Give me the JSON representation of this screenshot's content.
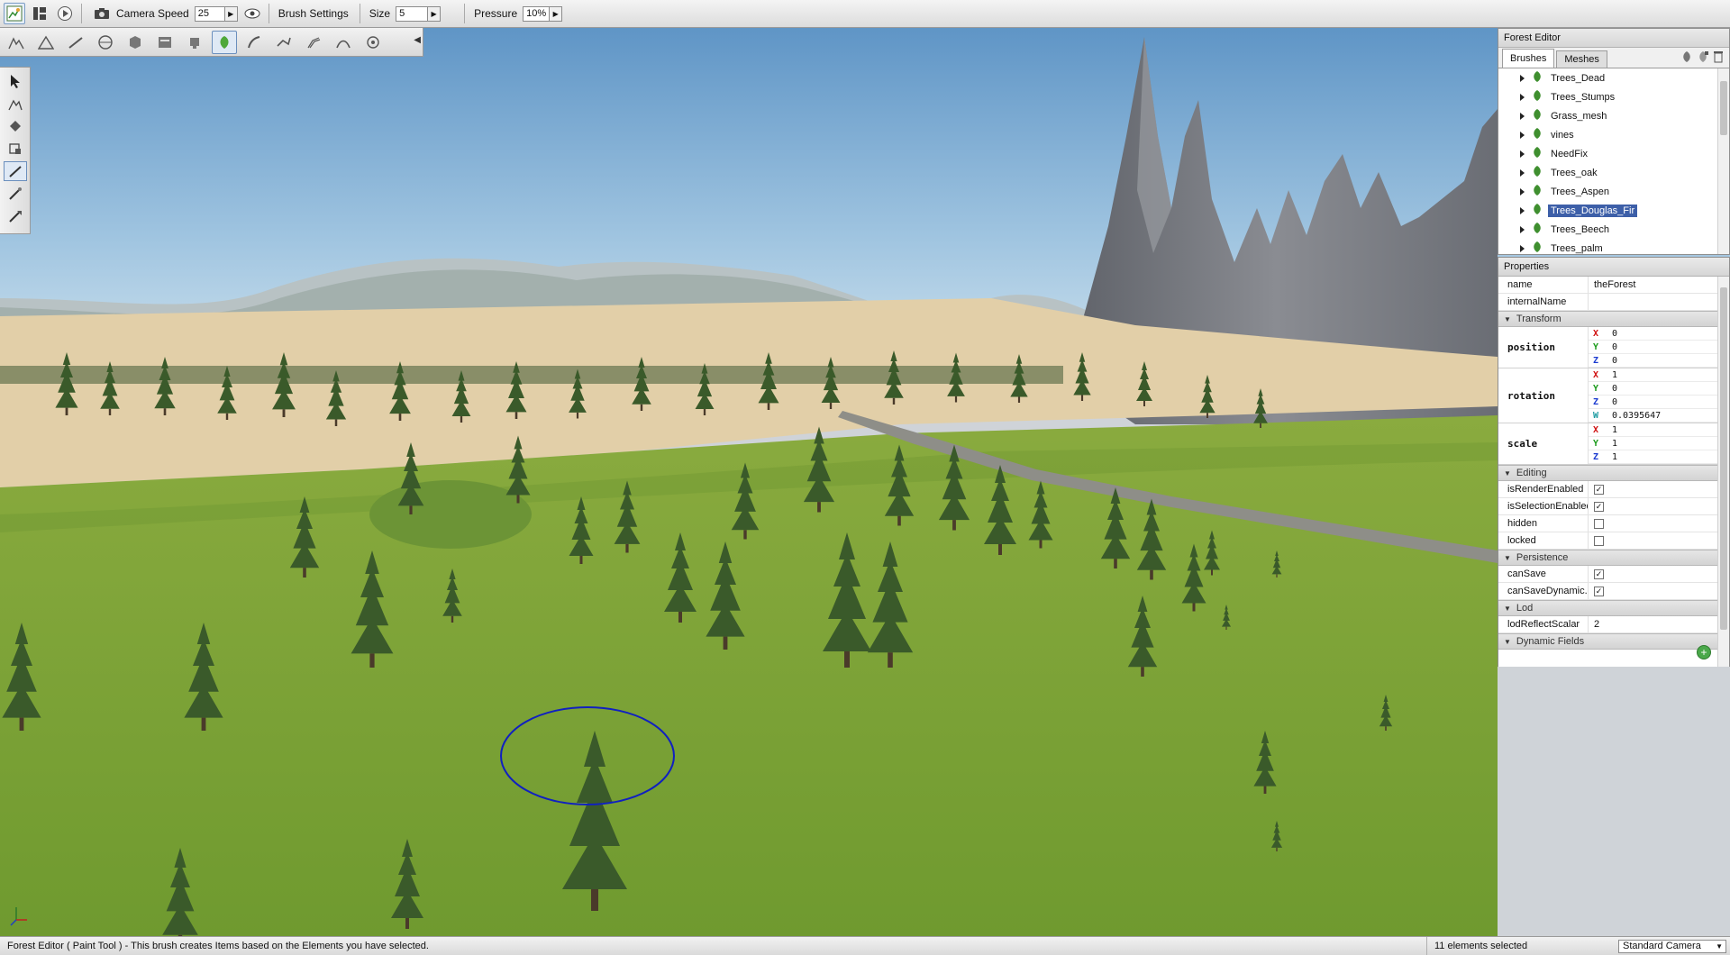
{
  "toolbar": {
    "camera_speed_label": "Camera Speed",
    "camera_speed_value": "25",
    "brush_settings_label": "Brush Settings",
    "size_label": "Size",
    "size_value": "5",
    "pressure_label": "Pressure",
    "pressure_value": "10%"
  },
  "forest_editor": {
    "title": "Forest Editor",
    "tabs": [
      "Brushes",
      "Meshes"
    ],
    "items": [
      {
        "label": "Trees_Dead"
      },
      {
        "label": "Trees_Stumps"
      },
      {
        "label": "Grass_mesh"
      },
      {
        "label": "vines"
      },
      {
        "label": "NeedFix"
      },
      {
        "label": "Trees_oak"
      },
      {
        "label": "Trees_Aspen"
      },
      {
        "label": "Trees_Douglas_Fir",
        "selected": true
      },
      {
        "label": "Trees_Beech"
      },
      {
        "label": "Trees_palm"
      }
    ]
  },
  "properties": {
    "title": "Properties",
    "name_label": "name",
    "name_value": "theForest",
    "internal_name_label": "internalName",
    "internal_name_value": "",
    "sections": {
      "transform": "Transform",
      "editing": "Editing",
      "persistence": "Persistence",
      "lod": "Lod",
      "dynamic_fields": "Dynamic Fields"
    },
    "position": {
      "label": "position",
      "x": "0",
      "y": "0",
      "z": "0"
    },
    "rotation": {
      "label": "rotation",
      "x": "1",
      "y": "0",
      "z": "0",
      "w": "0.0395647"
    },
    "scale": {
      "label": "scale",
      "x": "1",
      "y": "1",
      "z": "1"
    },
    "axis_labels": {
      "x": "X",
      "y": "Y",
      "z": "Z",
      "w": "W"
    },
    "axis_colors": {
      "x": "#d01010",
      "y": "#1a9a1a",
      "z": "#1a3ad0",
      "w": "#1a9aa0"
    },
    "editing": [
      {
        "label": "isRenderEnabled",
        "checked": true
      },
      {
        "label": "isSelectionEnabled",
        "checked": true
      },
      {
        "label": "hidden",
        "checked": false
      },
      {
        "label": "locked",
        "checked": false
      }
    ],
    "persistence": [
      {
        "label": "canSave",
        "checked": true
      },
      {
        "label": "canSaveDynamic...",
        "checked": true
      }
    ],
    "lod_reflect_label": "lodReflectScalar",
    "lod_reflect_value": "2"
  },
  "status": {
    "text": "Forest Editor ( Paint Tool ) - This brush creates Items based on the Elements you have selected.",
    "count": "11 elements selected",
    "camera": "Standard Camera"
  },
  "colors": {
    "selection": "#3d5fa8",
    "brush_ring": "#1020c0",
    "grass": "#7ea23a",
    "sand": "#e2cfa8",
    "sky_top": "#5f95c6",
    "sky_bottom": "#cfe3ef"
  }
}
